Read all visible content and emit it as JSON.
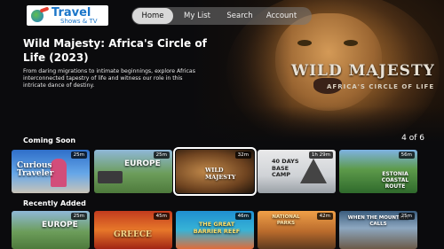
{
  "brand": {
    "name": "Travel",
    "tagline": "Shows & TV"
  },
  "nav": {
    "items": [
      "Home",
      "My List",
      "Search",
      "Account"
    ],
    "active": "Home"
  },
  "hero": {
    "title": "Wild Majesty: Africa's Circle of Life (2023)",
    "description": "From daring migrations to intimate beginnings, explore Africas interconnected tapestry of life and witness our role in this intricate dance of destiny.",
    "art_title": "WILD MAJESTY",
    "art_subtitle": "AFRICA'S CIRCLE OF LIFE"
  },
  "rows": {
    "coming_soon": {
      "label": "Coming Soon",
      "pager": "4 of 6",
      "items": [
        {
          "art": "Curious Traveler",
          "duration": "25m"
        },
        {
          "art": "EUROPE",
          "duration": "25m"
        },
        {
          "art": "WILD MAJESTY",
          "duration": "32m"
        },
        {
          "art": "40 DAYS BASE CAMP",
          "duration": "1h 29m"
        },
        {
          "art": "ESTONIA COASTAL ROUTE",
          "duration": "56m"
        }
      ]
    },
    "recently_added": {
      "label": "Recently Added",
      "items": [
        {
          "art": "EUROPE",
          "duration": "25m"
        },
        {
          "art": "GREECE",
          "duration": "45m"
        },
        {
          "art": "THE GREAT BARRIER REEF",
          "duration": "46m"
        },
        {
          "art": "NATIONAL PARKS",
          "duration": "42m"
        },
        {
          "art": "WHEN THE MOUNTAIN CALLS",
          "duration": "25m"
        }
      ]
    }
  }
}
